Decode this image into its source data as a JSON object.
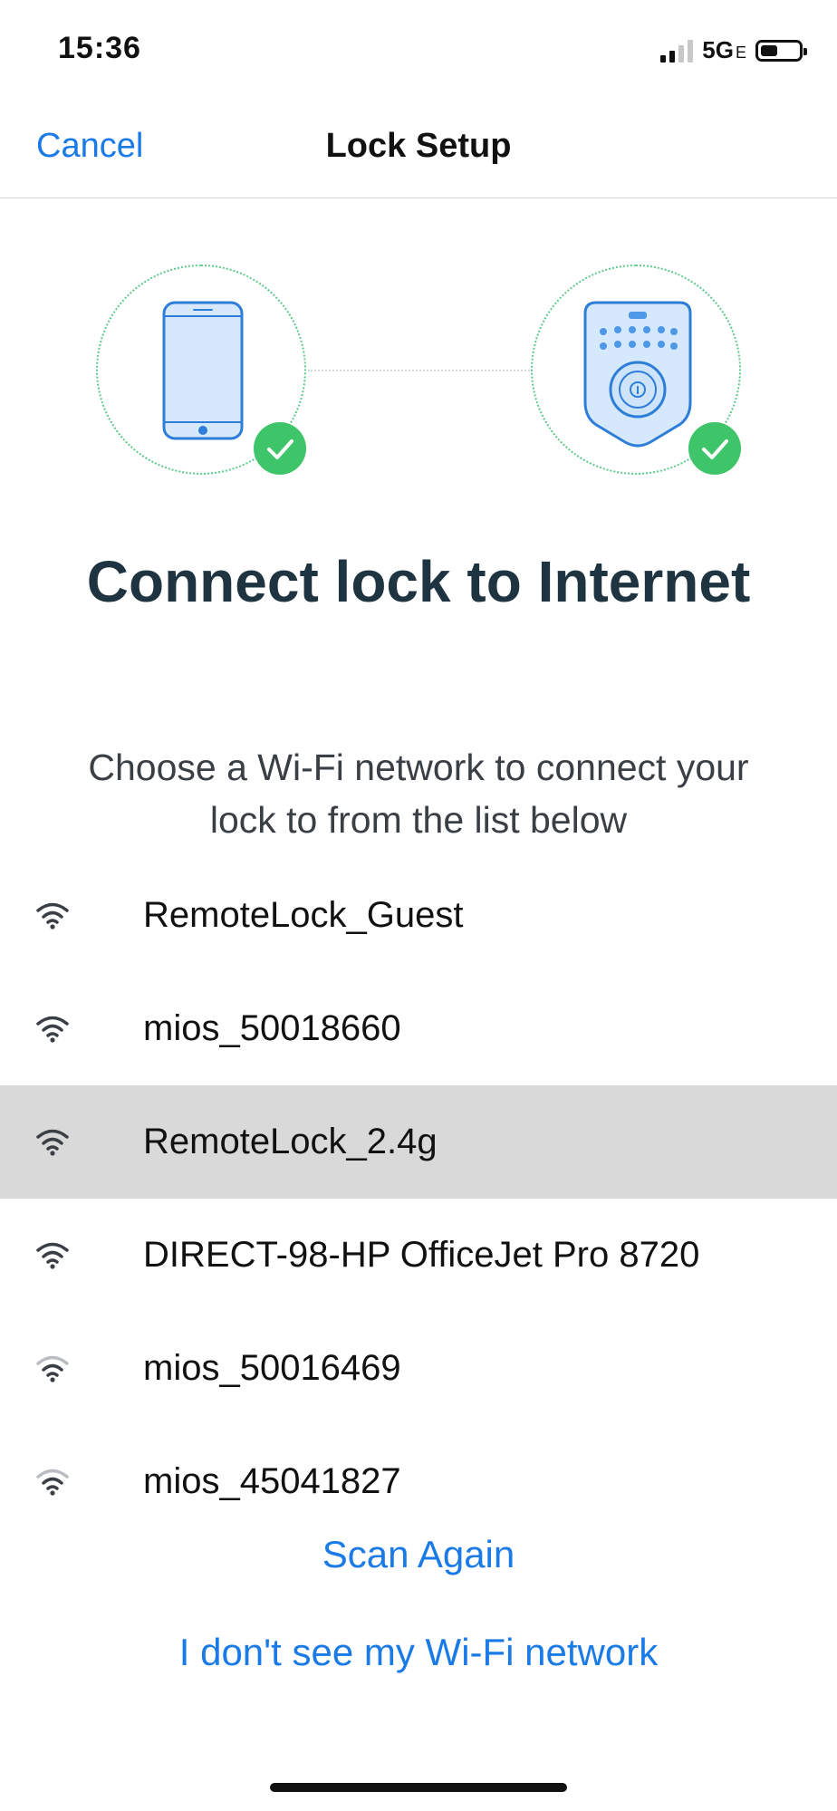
{
  "status_bar": {
    "time": "15:36",
    "network": "5G",
    "network_suffix": "E",
    "battery_level": 0.45
  },
  "nav": {
    "cancel_label": "Cancel",
    "title": "Lock Setup"
  },
  "illustration": {
    "left_device": "phone-icon",
    "right_device": "keypad-lock-icon",
    "check_icon": "check-icon",
    "accent_color": "#3ec56a",
    "device_color": "#d6e8fb"
  },
  "heading": "Connect lock to Internet",
  "subtext": "Choose a Wi-Fi network to connect your lock to from the list below",
  "networks": [
    {
      "ssid": "RemoteLock_Guest",
      "signal": 3,
      "selected": false
    },
    {
      "ssid": "mios_50018660",
      "signal": 3,
      "selected": false
    },
    {
      "ssid": "RemoteLock_2.4g",
      "signal": 3,
      "selected": true
    },
    {
      "ssid": "DIRECT-98-HP OfficeJet Pro 8720",
      "signal": 3,
      "selected": false
    },
    {
      "ssid": "mios_50016469",
      "signal": 2,
      "selected": false
    },
    {
      "ssid": "mios_45041827",
      "signal": 2,
      "selected": false
    }
  ],
  "actions": {
    "scan_again": "Scan Again",
    "not_listed": "I don't see my Wi-Fi network"
  },
  "colors": {
    "link": "#1a7ae6",
    "heading": "#1e3440",
    "selected_row": "#d9d9d9"
  }
}
